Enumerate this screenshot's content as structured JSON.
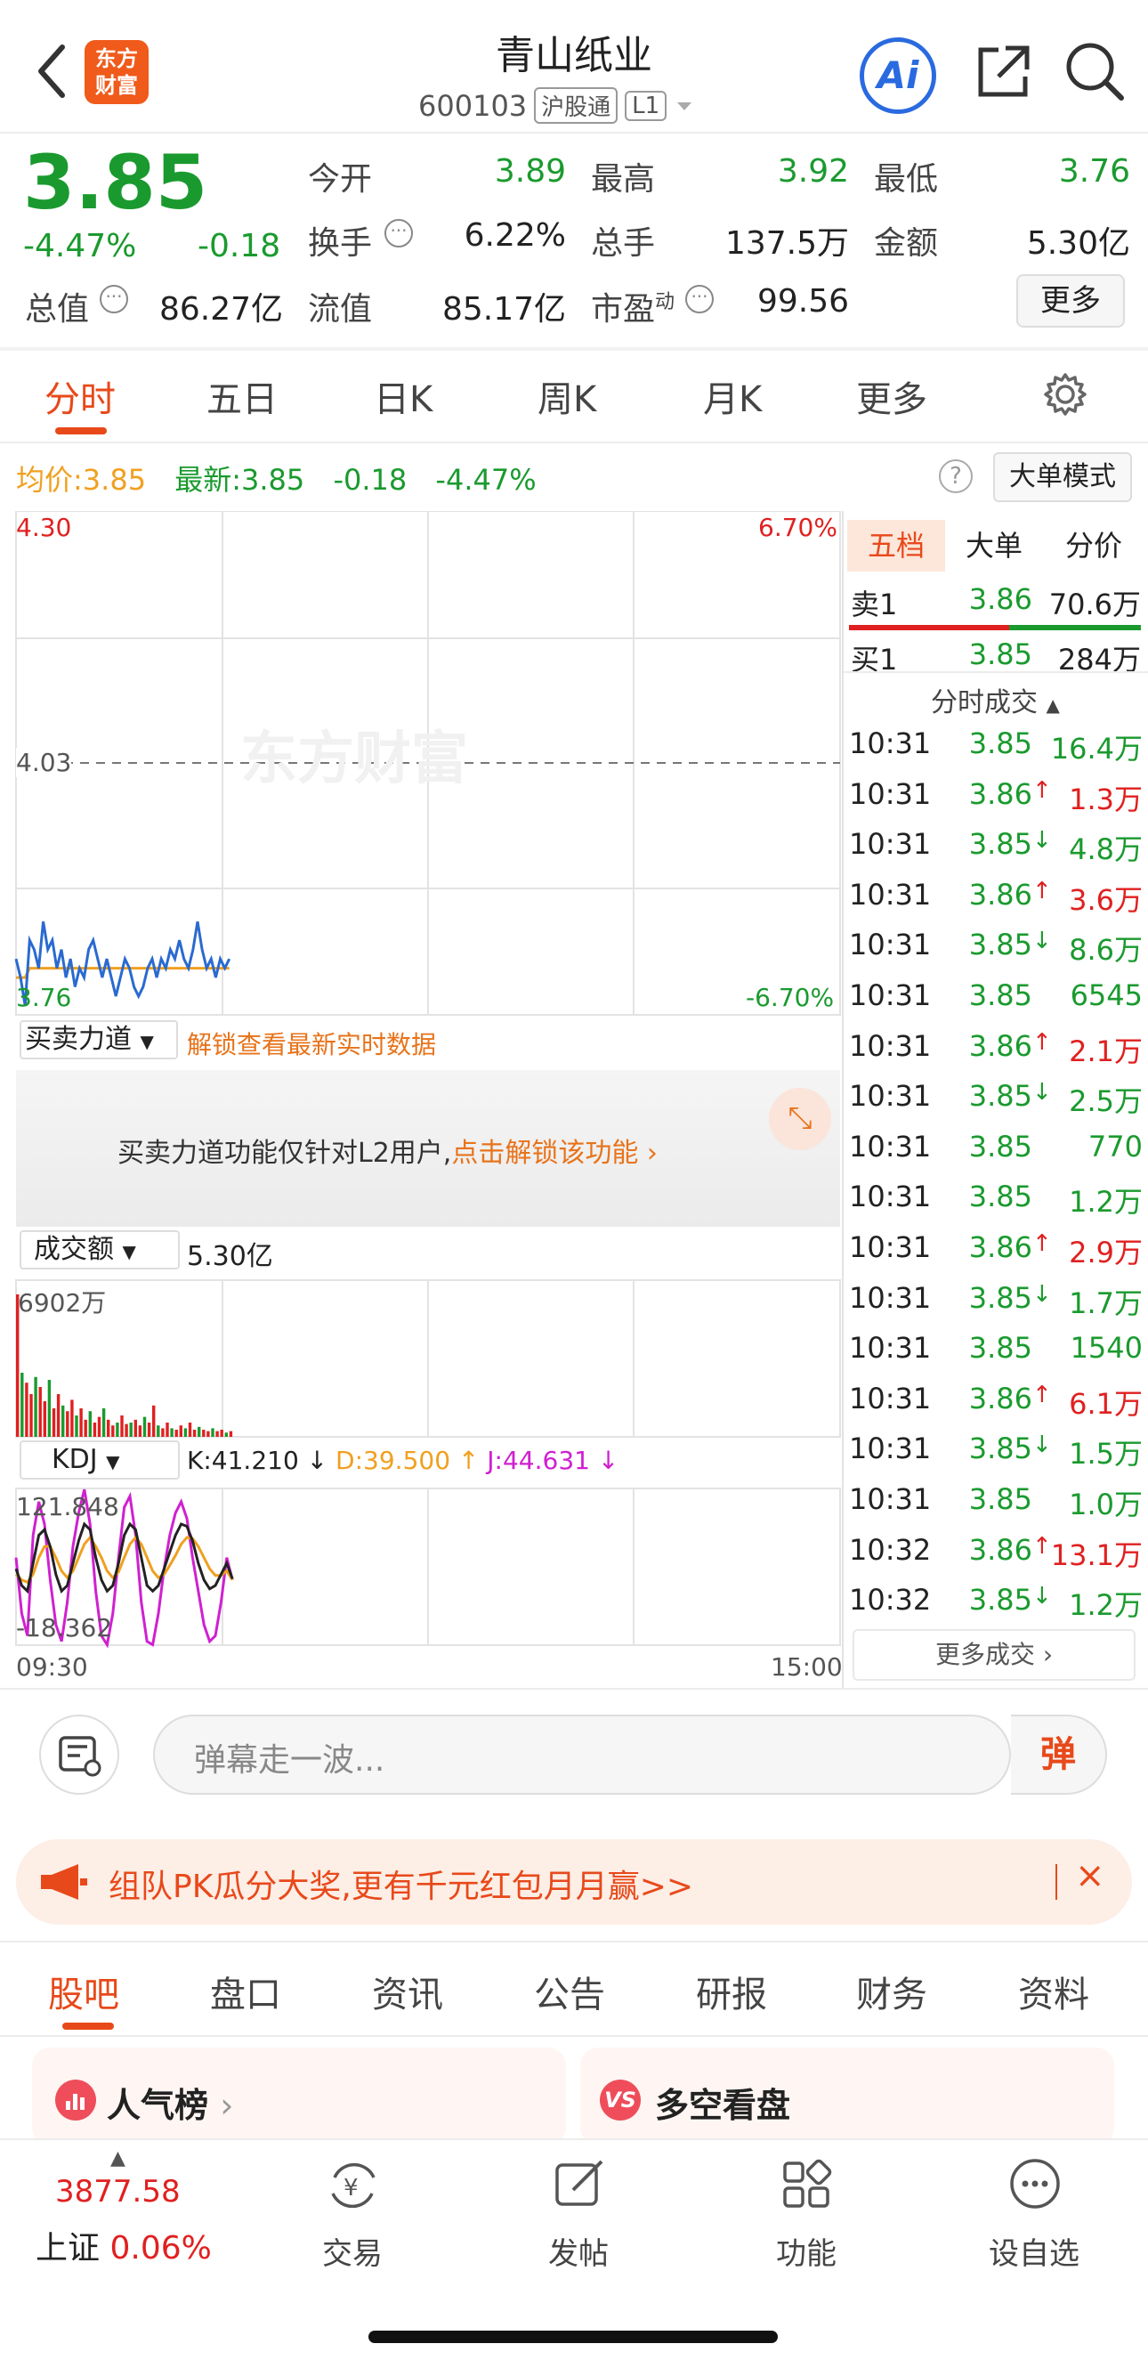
{
  "header": {
    "logo_text": "东方财富",
    "stock_name": "青山纸业",
    "stock_code": "600103",
    "tag_connect": "沪股通",
    "tag_level": "L1",
    "ai_label": "Ai"
  },
  "quote": {
    "price": "3.85",
    "change_pct": "-4.47%",
    "change": "-0.18",
    "stats": [
      {
        "label": "今开",
        "value": "3.89",
        "color": "green"
      },
      {
        "label": "最高",
        "value": "3.92",
        "color": "green"
      },
      {
        "label": "最低",
        "value": "3.76",
        "color": "green"
      },
      {
        "label": "换手",
        "value": "6.22%",
        "color": "black"
      },
      {
        "label": "总手",
        "value": "137.5万",
        "color": "black"
      },
      {
        "label": "金额",
        "value": "5.30亿",
        "color": "black"
      },
      {
        "label": "总值",
        "value": "86.27亿",
        "color": "black"
      },
      {
        "label": "流值",
        "value": "85.17亿",
        "color": "black"
      },
      {
        "label": "市盈",
        "sup": "动",
        "value": "99.56",
        "color": "black"
      }
    ],
    "more_label": "更多"
  },
  "period_tabs": [
    "分时",
    "五日",
    "日K",
    "周K",
    "月K",
    "更多"
  ],
  "info_bar": {
    "avg_label": "均价:",
    "avg_value": "3.85",
    "latest_label": "最新:",
    "latest_price": "3.85",
    "latest_change": "-0.18",
    "latest_pct": "-4.47%",
    "big_order_mode": "大单模式"
  },
  "chart": {
    "price_high": "4.30",
    "pct_high": "6.70%",
    "price_mid": "4.03",
    "price_low": "3.76",
    "pct_low": "-6.70%",
    "watermark": "东方财富",
    "force_label": "买卖力道",
    "force_unlock": "解锁查看最新实时数据",
    "force_notice": "买卖力道功能仅针对L2用户,",
    "force_cta": "点击解锁该功能",
    "volume_label": "成交额",
    "volume_value": "5.30亿",
    "volume_max": "6902万",
    "kdj_label": "KDJ",
    "kdj_k": "K:41.210 ↓",
    "kdj_d": "D:39.500 ↑",
    "kdj_j": "J:44.631 ↓",
    "kdj_high": "121.848",
    "kdj_low": "-18.362",
    "time_start": "09:30",
    "time_end": "15:00"
  },
  "right_panel": {
    "tabs": [
      "五档",
      "大单",
      "分价"
    ],
    "sell1": {
      "label": "卖1",
      "price": "3.86",
      "vol": "70.6万"
    },
    "buy1": {
      "label": "买1",
      "price": "3.85",
      "vol": "284万"
    },
    "ticks_title": "分时成交",
    "ticks": [
      {
        "time": "10:31",
        "price": "3.85",
        "arrow": "",
        "vol": "16.4万",
        "vc": "green"
      },
      {
        "time": "10:31",
        "price": "3.86",
        "arrow": "↑",
        "vol": "1.3万",
        "vc": "red"
      },
      {
        "time": "10:31",
        "price": "3.85",
        "arrow": "↓",
        "vol": "4.8万",
        "vc": "green"
      },
      {
        "time": "10:31",
        "price": "3.86",
        "arrow": "↑",
        "vol": "3.6万",
        "vc": "red"
      },
      {
        "time": "10:31",
        "price": "3.85",
        "arrow": "↓",
        "vol": "8.6万",
        "vc": "green"
      },
      {
        "time": "10:31",
        "price": "3.85",
        "arrow": "",
        "vol": "6545",
        "vc": "green"
      },
      {
        "time": "10:31",
        "price": "3.86",
        "arrow": "↑",
        "vol": "2.1万",
        "vc": "red"
      },
      {
        "time": "10:31",
        "price": "3.85",
        "arrow": "↓",
        "vol": "2.5万",
        "vc": "green"
      },
      {
        "time": "10:31",
        "price": "3.85",
        "arrow": "",
        "vol": "770",
        "vc": "green"
      },
      {
        "time": "10:31",
        "price": "3.85",
        "arrow": "",
        "vol": "1.2万",
        "vc": "green"
      },
      {
        "time": "10:31",
        "price": "3.86",
        "arrow": "↑",
        "vol": "2.9万",
        "vc": "red"
      },
      {
        "time": "10:31",
        "price": "3.85",
        "arrow": "↓",
        "vol": "1.7万",
        "vc": "green"
      },
      {
        "time": "10:31",
        "price": "3.85",
        "arrow": "",
        "vol": "1540",
        "vc": "green"
      },
      {
        "time": "10:31",
        "price": "3.86",
        "arrow": "↑",
        "vol": "6.1万",
        "vc": "red"
      },
      {
        "time": "10:31",
        "price": "3.85",
        "arrow": "↓",
        "vol": "1.5万",
        "vc": "green"
      },
      {
        "time": "10:31",
        "price": "3.85",
        "arrow": "",
        "vol": "1.0万",
        "vc": "green"
      },
      {
        "time": "10:32",
        "price": "3.86",
        "arrow": "↑",
        "vol": "13.1万",
        "vc": "red"
      },
      {
        "time": "10:32",
        "price": "3.85",
        "arrow": "↓",
        "vol": "1.2万",
        "vc": "green"
      }
    ],
    "more_ticks": "更多成交"
  },
  "comment": {
    "placeholder": "弹幕走一波...",
    "danmu_btn": "弹"
  },
  "banner": {
    "text": "组队PK瓜分大奖,更有千元红包月月赢>>"
  },
  "bottom_tabs": [
    "股吧",
    "盘口",
    "资讯",
    "公告",
    "研报",
    "财务",
    "资料"
  ],
  "cards": {
    "popular": "人气榜",
    "vs": "多空看盘"
  },
  "bottom_nav": {
    "index_value": "3877.58",
    "index_name": "上证",
    "index_pct": "0.06%",
    "items": [
      "交易",
      "发帖",
      "功能",
      "设自选"
    ]
  },
  "colors": {
    "up": "#e02020",
    "down": "#1a9a2e",
    "accent": "#e8491a",
    "avg_line": "#f0a020",
    "price_line": "#2a6ad0",
    "kdj_j": "#d020d0"
  }
}
